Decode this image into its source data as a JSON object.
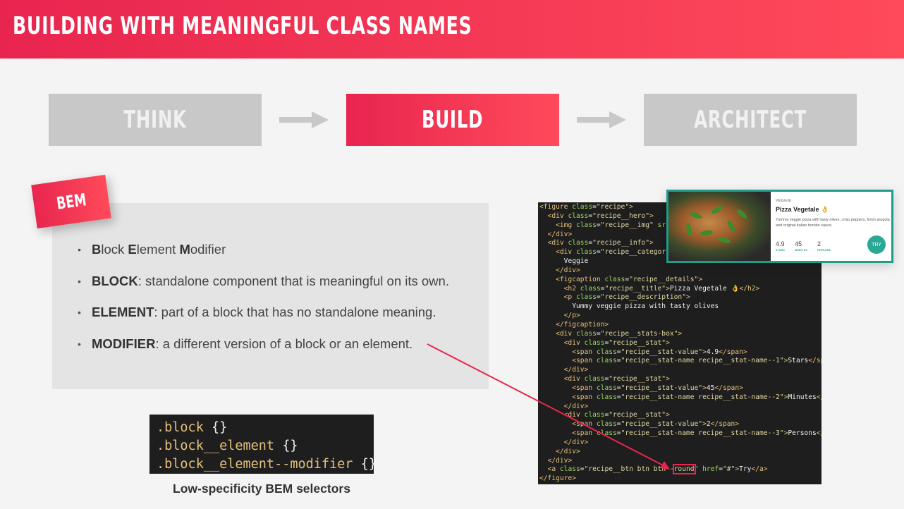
{
  "header": {
    "title": "BUILDING WITH MEANINGFUL CLASS NAMES"
  },
  "steps": {
    "think": "THINK",
    "build": "BUILD",
    "architect": "ARCHITECT"
  },
  "bem": {
    "tag": "BEM",
    "bullets": [
      {
        "bold": "",
        "text": ""
      },
      {
        "bold": "BLOCK",
        "text": ": standalone component that is meaningful on its own."
      },
      {
        "bold": "ELEMENT",
        "text": ": part of a block that has no standalone meaning."
      },
      {
        "bold": "MODIFIER",
        "text": ": a different version of a block or an element."
      }
    ],
    "bullet0": {
      "b1": "B",
      "t1": "lock ",
      "b2": "E",
      "t2": "lement ",
      "b3": "M",
      "t3": "odifier"
    }
  },
  "selectors": {
    "lines": [
      ".block",
      ".block__element",
      ".block__element--modifier"
    ],
    "braces": "{}",
    "caption": "Low-specificity BEM selectors"
  },
  "card": {
    "category": "VEGGIE",
    "title": "Pizza Vegetale 👌",
    "description": "Yummy veggie pizza with tasty olives, crisp peppers, fresh arugula and original italian tomato sauce.",
    "stats": [
      {
        "value": "4.9",
        "name": "STARS"
      },
      {
        "value": "45",
        "name": "MINUTES"
      },
      {
        "value": "2",
        "name": "PERSONS"
      }
    ],
    "button": "TRY"
  },
  "colors": {
    "accent": "#e8254f",
    "teal": "#1f9b8b",
    "gray": "#c8c8c8"
  }
}
